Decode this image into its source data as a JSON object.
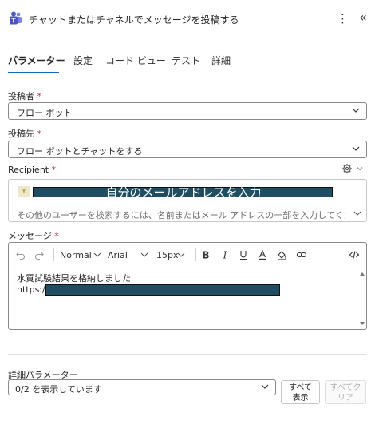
{
  "header": {
    "title": "チャットまたはチャネルでメッセージを投稿する",
    "more_icon": "more-vertical-icon",
    "collapse_icon": "double-chevron-left-icon",
    "app_icon": "teams-icon"
  },
  "tabs": [
    {
      "label": "パラメーター",
      "active": true
    },
    {
      "label": "設定",
      "active": false
    },
    {
      "label": "コード ビュー",
      "active": false
    },
    {
      "label": "テスト",
      "active": false
    },
    {
      "label": "詳細",
      "active": false
    }
  ],
  "fields": {
    "poster": {
      "label": "投稿者",
      "required": "*",
      "value": "フロー ボット"
    },
    "post_in": {
      "label": "投稿先",
      "required": "*",
      "value": "フロー ボットとチャットをする"
    },
    "recipient": {
      "label": "Recipient",
      "required": "*",
      "avatar_initial": "Y",
      "redacted_overlay_text": "自分のメールアドレスを入力",
      "search_placeholder": "その他のユーザーを検索するには、名前またはメール アドレスの一部を入力してください"
    },
    "message": {
      "label": "メッセージ",
      "required": "*",
      "toolbar": {
        "format": "Normal",
        "font": "Arial",
        "size": "15px"
      },
      "line1": "水質試験結果を格納しました",
      "line2_prefix": "https://"
    }
  },
  "advanced": {
    "label": "詳細パラメーター",
    "value": "0/2 を表示しています",
    "show_all": "すべて\n表示",
    "clear_all": "すべてク\nリア"
  },
  "colors": {
    "accent": "#0f6cbd",
    "required": "#c4314b",
    "redaction": "#1f4e63"
  }
}
